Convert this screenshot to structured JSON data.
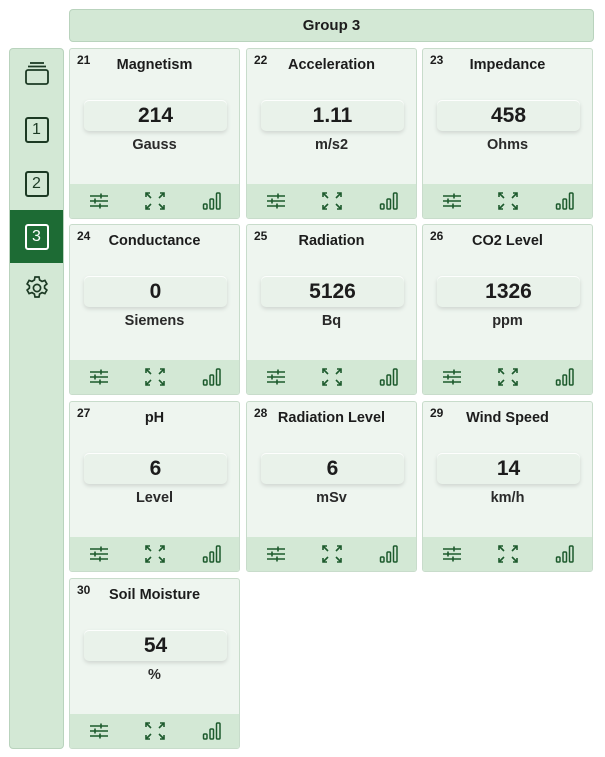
{
  "header": {
    "title": "Group 3"
  },
  "sidebar": {
    "items": [
      {
        "kind": "icon",
        "icon": "layers-icon"
      },
      {
        "kind": "number",
        "label": "1"
      },
      {
        "kind": "number",
        "label": "2"
      },
      {
        "kind": "number",
        "label": "3",
        "active": true
      },
      {
        "kind": "icon",
        "icon": "gear-icon"
      }
    ]
  },
  "colors": {
    "accent": "#1d6b34",
    "panel": "#d3e8d5",
    "tile": "#eef5ef"
  },
  "tiles": [
    {
      "index": "21",
      "title": "Magnetism",
      "value": "214",
      "unit": "Gauss"
    },
    {
      "index": "22",
      "title": "Acceleration",
      "value": "1.11",
      "unit": "m/s2"
    },
    {
      "index": "23",
      "title": "Impedance",
      "value": "458",
      "unit": "Ohms"
    },
    {
      "index": "24",
      "title": "Conductance",
      "value": "0",
      "unit": "Siemens"
    },
    {
      "index": "25",
      "title": "Radiation",
      "value": "5126",
      "unit": "Bq"
    },
    {
      "index": "26",
      "title": "CO2 Level",
      "value": "1326",
      "unit": "ppm"
    },
    {
      "index": "27",
      "title": "pH",
      "value": "6",
      "unit": "Level"
    },
    {
      "index": "28",
      "title": "Radiation Level",
      "value": "6",
      "unit": "mSv"
    },
    {
      "index": "29",
      "title": "Wind Speed",
      "value": "14",
      "unit": "km/h"
    },
    {
      "index": "30",
      "title": "Soil Moisture",
      "value": "54",
      "unit": "%"
    }
  ],
  "tile_actions": [
    "sliders-icon",
    "expand-icon",
    "signal-bars-icon"
  ]
}
